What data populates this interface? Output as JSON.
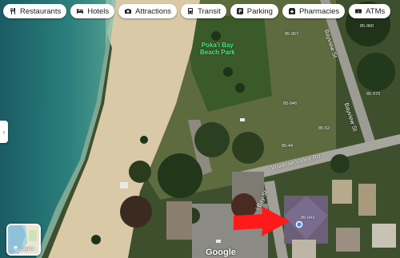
{
  "categories": [
    {
      "label": "Restaurants",
      "icon": "fork-knife-icon"
    },
    {
      "label": "Hotels",
      "icon": "bed-icon"
    },
    {
      "label": "Attractions",
      "icon": "camera-icon"
    },
    {
      "label": "Transit",
      "icon": "bus-icon"
    },
    {
      "label": "Parking",
      "icon": "parking-icon"
    },
    {
      "label": "Pharmacies",
      "icon": "pharmacy-icon"
    },
    {
      "label": "ATMs",
      "icon": "atm-icon"
    }
  ],
  "map": {
    "park_name_line1": "Poka'i Bay",
    "park_name_line2": "Beach Park",
    "streets": {
      "bayview_top": "Bayview St",
      "bayview_lower": "Bayview St",
      "waianae_valley": "Waianae Valley Rd",
      "bay_st": "i Bay St"
    },
    "house_numbers": [
      "85-957",
      "85-960",
      "85-970",
      "85-946",
      "85-52",
      "85-44",
      "85-043"
    ]
  },
  "marker": {
    "arrow_color": "#ff1a1a",
    "pin_color": "#4285f4"
  },
  "layers_button": {
    "label": "Layers"
  },
  "attribution": {
    "logo": "Google"
  },
  "colors": {
    "ocean": "#1f6f73",
    "sand": "#d8c7a6",
    "vegetation": "#2f4a22"
  }
}
